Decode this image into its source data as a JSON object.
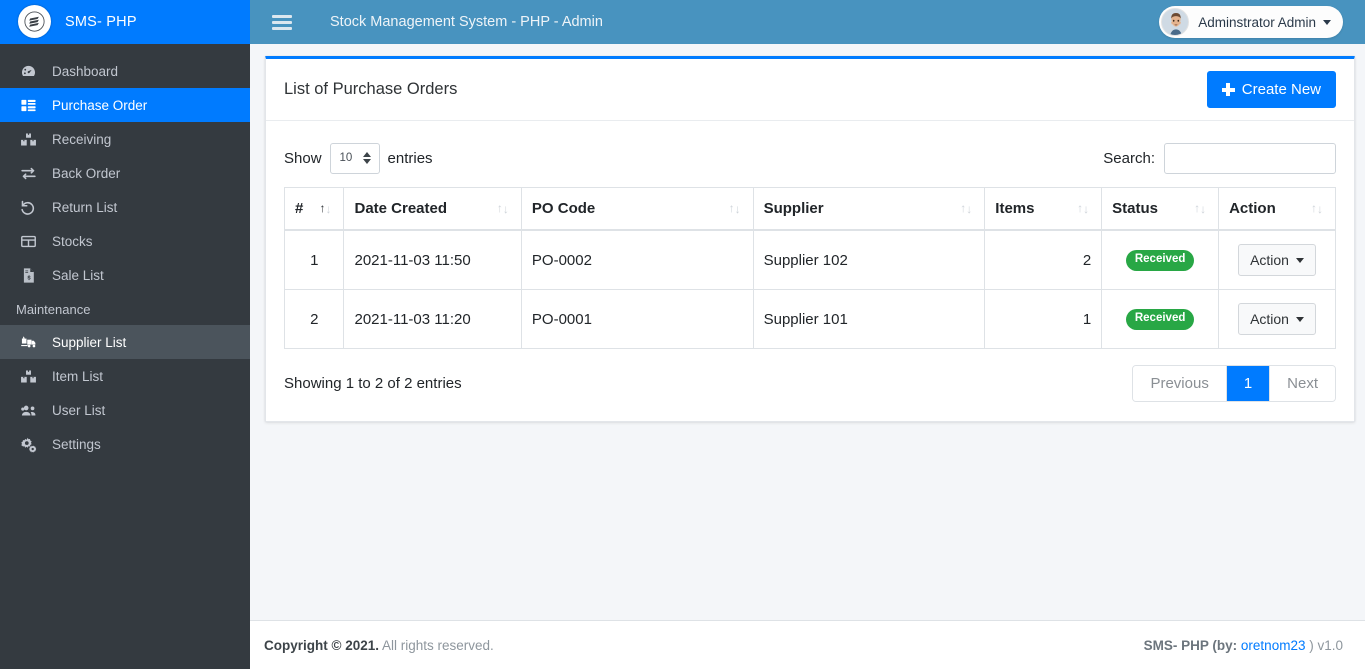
{
  "brand": {
    "name": "SMS- PHP",
    "logo_icon": "stack-logo-icon"
  },
  "sidebar": {
    "items": [
      {
        "label": "Dashboard",
        "icon": "dashboard-gauge-icon",
        "state": "normal"
      },
      {
        "label": "Purchase Order",
        "icon": "table-blocks-icon",
        "state": "active"
      },
      {
        "label": "Receiving",
        "icon": "boxes-icon",
        "state": "normal"
      },
      {
        "label": "Back Order",
        "icon": "exchange-arrows-icon",
        "state": "normal"
      },
      {
        "label": "Return List",
        "icon": "undo-arrow-icon",
        "state": "normal"
      },
      {
        "label": "Stocks",
        "icon": "grid-table-icon",
        "state": "normal"
      },
      {
        "label": "Sale List",
        "icon": "invoice-dollar-icon",
        "state": "normal"
      }
    ],
    "section_header": "Maintenance",
    "maintenance_items": [
      {
        "label": "Supplier List",
        "icon": "truck-loading-icon",
        "state": "hover"
      },
      {
        "label": "Item List",
        "icon": "boxes-icon",
        "state": "normal"
      },
      {
        "label": "User List",
        "icon": "users-icon",
        "state": "normal"
      },
      {
        "label": "Settings",
        "icon": "cogs-icon",
        "state": "normal"
      }
    ]
  },
  "topbar": {
    "menu_icon": "hamburger-icon",
    "title": "Stock Management System - PHP - Admin",
    "user_name": "Adminstrator Admin",
    "avatar_icon": "user-avatar-icon",
    "caret_icon": "caret-down-icon"
  },
  "card": {
    "title": "List of Purchase Orders",
    "create_button": "Create New",
    "create_icon": "plus-icon"
  },
  "datatable": {
    "show_label": "Show",
    "entries_label": "entries",
    "page_length": "10",
    "search_label": "Search:",
    "search_value": "",
    "search_placeholder": "",
    "columns": [
      "#",
      "Date Created",
      "PO Code",
      "Supplier",
      "Items",
      "Status",
      "Action"
    ],
    "sorted_column": "#",
    "sort_direction": "asc",
    "rows": [
      {
        "num": "1",
        "date_created": "2021-11-03 11:50",
        "po_code": "PO-0002",
        "supplier": "Supplier 102",
        "items": "2",
        "status": "Received",
        "action_label": "Action"
      },
      {
        "num": "2",
        "date_created": "2021-11-03 11:20",
        "po_code": "PO-0001",
        "supplier": "Supplier 101",
        "items": "1",
        "status": "Received",
        "action_label": "Action"
      }
    ],
    "info": "Showing 1 to 2 of 2 entries",
    "pagination": {
      "previous": "Previous",
      "pages": [
        "1"
      ],
      "next": "Next",
      "current": "1"
    }
  },
  "footer": {
    "copyright_bold": "Copyright © 2021.",
    "copyright_rest": "All rights reserved.",
    "right_prefix": "SMS- PHP (by:",
    "right_link": "oretnom23",
    "right_suffix": ") v1.0"
  },
  "colors": {
    "sidebar_bg": "#343a40",
    "accent_blue": "#007bff",
    "topbar_blue": "#4893bf",
    "status_green": "#28a745",
    "content_bg": "#f4f6f9"
  }
}
